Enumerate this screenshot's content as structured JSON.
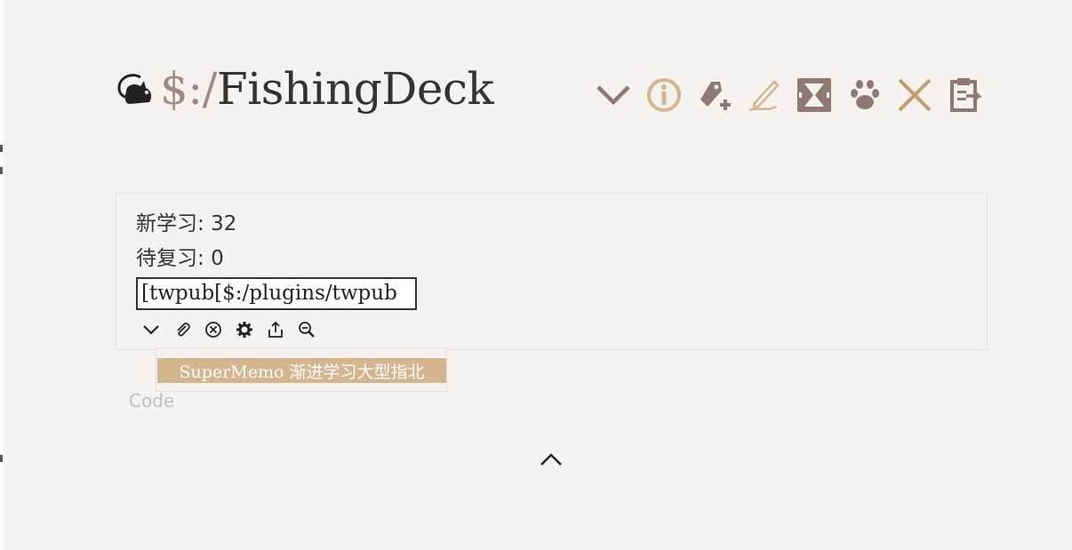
{
  "title": {
    "prefix": "$:/",
    "name": "FishingDeck"
  },
  "toolbar": {
    "buttons": [
      {
        "name": "more-icon",
        "color": "#8f7a72"
      },
      {
        "name": "info-icon",
        "color": "#d4b58e"
      },
      {
        "name": "new-tag-icon",
        "color": "#8f7a72"
      },
      {
        "name": "edit-icon",
        "color": "#d4b58e"
      },
      {
        "name": "fold-icon",
        "color": "#8f7a72"
      },
      {
        "name": "paw-icon",
        "color": "#8f7a72"
      },
      {
        "name": "close-icon",
        "color": "#c39e6b"
      },
      {
        "name": "export-icon",
        "color": "#8f7a72"
      }
    ]
  },
  "stats": {
    "new_label": "新学习",
    "new_value": "32",
    "review_label": "待复习",
    "review_value": "0"
  },
  "input": {
    "value": "[twpub[$:/plugins/twpub"
  },
  "mini_toolbar": [
    "chevron-down-icon",
    "paperclip-icon",
    "clear-icon",
    "gear-icon",
    "share-icon",
    "zoom-out-icon"
  ],
  "dropdown": {
    "item": "SuperMemo 渐进学习大型指北"
  },
  "code_label": "Code",
  "colors": {
    "accent": "#d4b58e",
    "muted": "#8f7a72",
    "background": "#f6f2ef"
  }
}
